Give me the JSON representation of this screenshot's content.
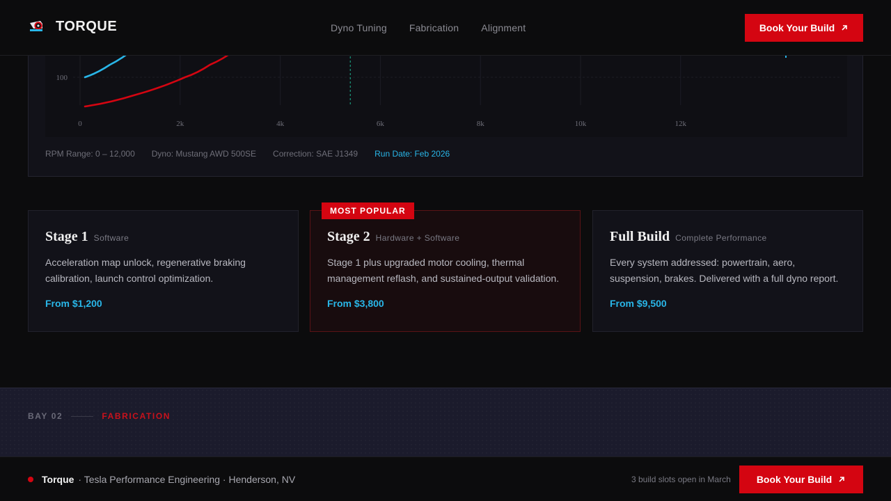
{
  "brand": {
    "name": "TORQUE",
    "logo": "racing-helmet-icon"
  },
  "nav": {
    "items": [
      "Dyno Tuning",
      "Fabrication",
      "Alignment"
    ]
  },
  "header": {
    "cta_label": "Book Your Build",
    "cta_icon": "arrow-up-right-icon"
  },
  "colors": {
    "accent_red": "#d40511",
    "accent_cyan": "#29b6e8",
    "background": "#0c0c0d",
    "panel": "#121219"
  },
  "chart_data": {
    "type": "line",
    "title": "",
    "xlabel": "",
    "ylabel": "",
    "x_ticks": [
      "0",
      "2k",
      "4k",
      "6k",
      "8k",
      "10k",
      "12k"
    ],
    "y_ticks_visible": [
      "100"
    ],
    "xlim": [
      0,
      12000
    ],
    "grid": true,
    "series": [
      {
        "color": "#29b6e8",
        "x": [
          0,
          500,
          1000,
          1500
        ],
        "y": [
          100,
          112,
          128,
          148
        ]
      },
      {
        "color": "#d40511",
        "x": [
          0,
          1000,
          2000,
          2500,
          3000
        ],
        "y": [
          72,
          83,
          100,
          112,
          126
        ]
      }
    ],
    "marker_x": 5400
  },
  "chart_meta": {
    "rpm_range": "RPM Range: 0 – 12,000",
    "dyno": "Dyno: Mustang AWD 500SE",
    "correction": "Correction: SAE J1349",
    "run_date": "Run Date: Feb 2026"
  },
  "plans": [
    {
      "title": "Stage 1",
      "subtitle": "Software",
      "description": "Acceleration map unlock, regenerative braking calibration, launch control optimization.",
      "price": "From $1,200"
    },
    {
      "title": "Stage 2",
      "subtitle": "Hardware + Software",
      "description": "Stage 1 plus upgraded motor cooling, thermal management reflash, and sustained-output validation.",
      "price": "From $3,800",
      "badge": "MOST POPULAR"
    },
    {
      "title": "Full Build",
      "subtitle": "Complete Performance",
      "description": "Every system addressed: powertrain, aero, suspension, brakes. Delivered with a full dyno report.",
      "price": "From $9,500"
    }
  ],
  "bay": {
    "number": "BAY 02",
    "label": "FABRICATION"
  },
  "footer": {
    "brand": "Torque",
    "tagline": "· Tesla Performance Engineering · Henderson, NV",
    "slots": "3 build slots open in March",
    "cta_label": "Book Your Build"
  }
}
